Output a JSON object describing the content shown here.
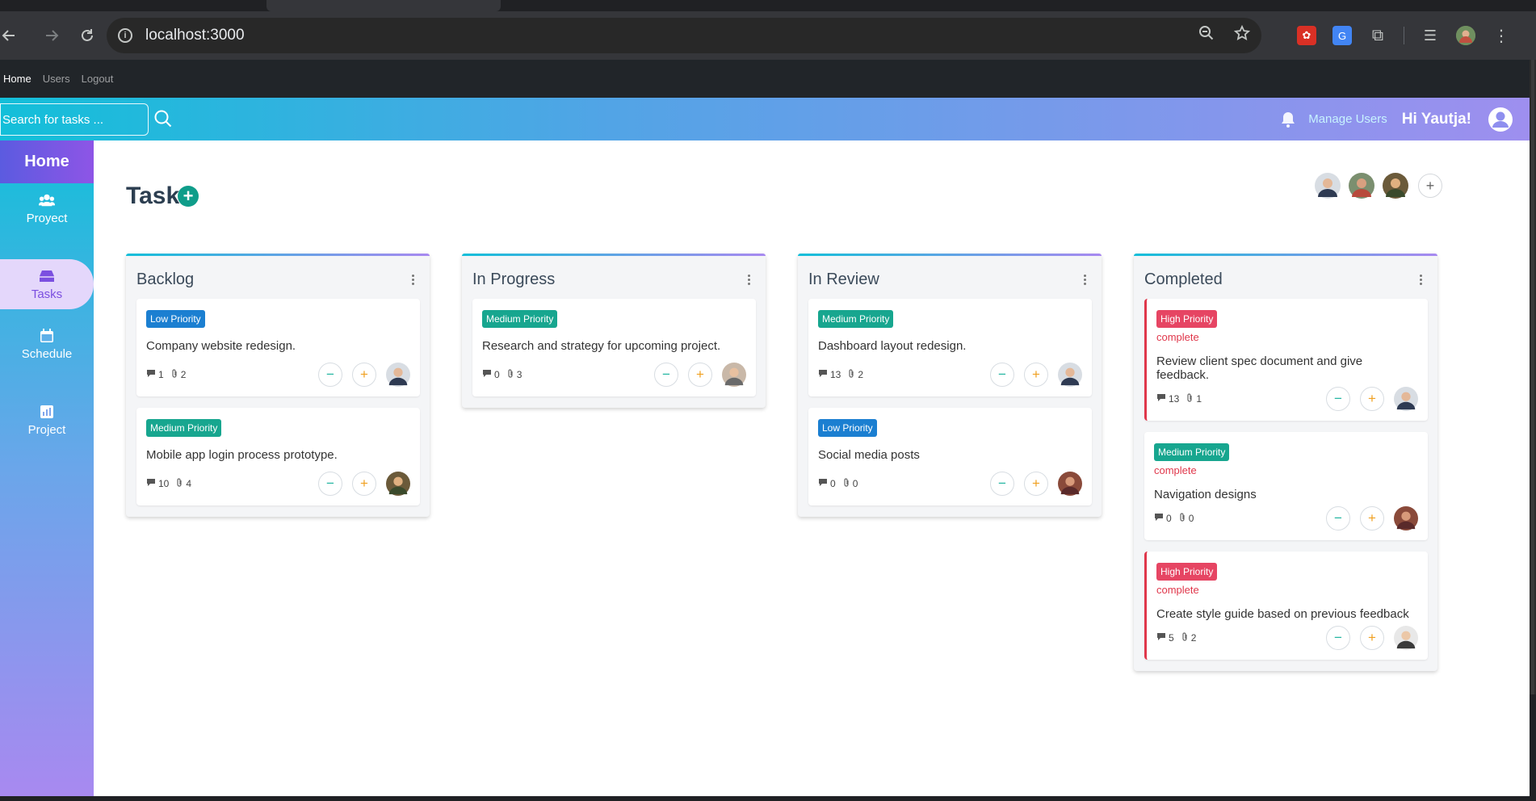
{
  "browser": {
    "url": "localhost:3000"
  },
  "appbar": {
    "links": [
      "Home",
      "Users",
      "Logout"
    ]
  },
  "header": {
    "search_placeholder": "Search for tasks ...",
    "manage_users": "Manage Users",
    "greeting": "Hi Yautja!"
  },
  "sidebar": {
    "home": "Home",
    "items": [
      {
        "label": "Proyect",
        "icon": "people-icon"
      },
      {
        "label": "Tasks",
        "icon": "tray-icon"
      },
      {
        "label": "Schedule",
        "icon": "calendar-icon"
      },
      {
        "label": "Project",
        "icon": "chart-icon"
      }
    ]
  },
  "main": {
    "title": "Task",
    "add_symbol": "+",
    "add_member_symbol": "+"
  },
  "columns": [
    {
      "title": "Backlog",
      "cards": [
        {
          "priority": "Low Priority",
          "level": "low",
          "status": "",
          "text": "Company website redesign.",
          "comments": "1",
          "attachments": "2"
        },
        {
          "priority": "Medium Priority",
          "level": "medium",
          "status": "",
          "text": "Mobile app login process prototype.",
          "comments": "10",
          "attachments": "4"
        }
      ]
    },
    {
      "title": "In Progress",
      "cards": [
        {
          "priority": "Medium Priority",
          "level": "medium",
          "status": "",
          "text": "Research and strategy for upcoming project.",
          "comments": "0",
          "attachments": "3"
        }
      ]
    },
    {
      "title": "In Review",
      "cards": [
        {
          "priority": "Medium Priority",
          "level": "medium",
          "status": "",
          "text": "Dashboard layout redesign.",
          "comments": "13",
          "attachments": "2"
        },
        {
          "priority": "Low Priority",
          "level": "low",
          "status": "",
          "text": "Social media posts",
          "comments": "0",
          "attachments": "0"
        }
      ]
    },
    {
      "title": "Completed",
      "cards": [
        {
          "priority": "High Priority",
          "level": "high",
          "status": "complete",
          "text": "Review client spec document and give feedback.",
          "comments": "13",
          "attachments": "1"
        },
        {
          "priority": "Medium Priority",
          "level": "medium",
          "status": "complete",
          "text": "Navigation designs",
          "comments": "0",
          "attachments": "0"
        },
        {
          "priority": "High Priority",
          "level": "high",
          "status": "complete",
          "text": "Create style guide based on previous feedback",
          "comments": "5",
          "attachments": "2"
        }
      ]
    }
  ],
  "colors": {
    "accent_teal": "#13bfd9",
    "accent_purple": "#a889f0",
    "low": "#1b7fd1",
    "medium": "#17a68f",
    "high": "#e64563"
  }
}
